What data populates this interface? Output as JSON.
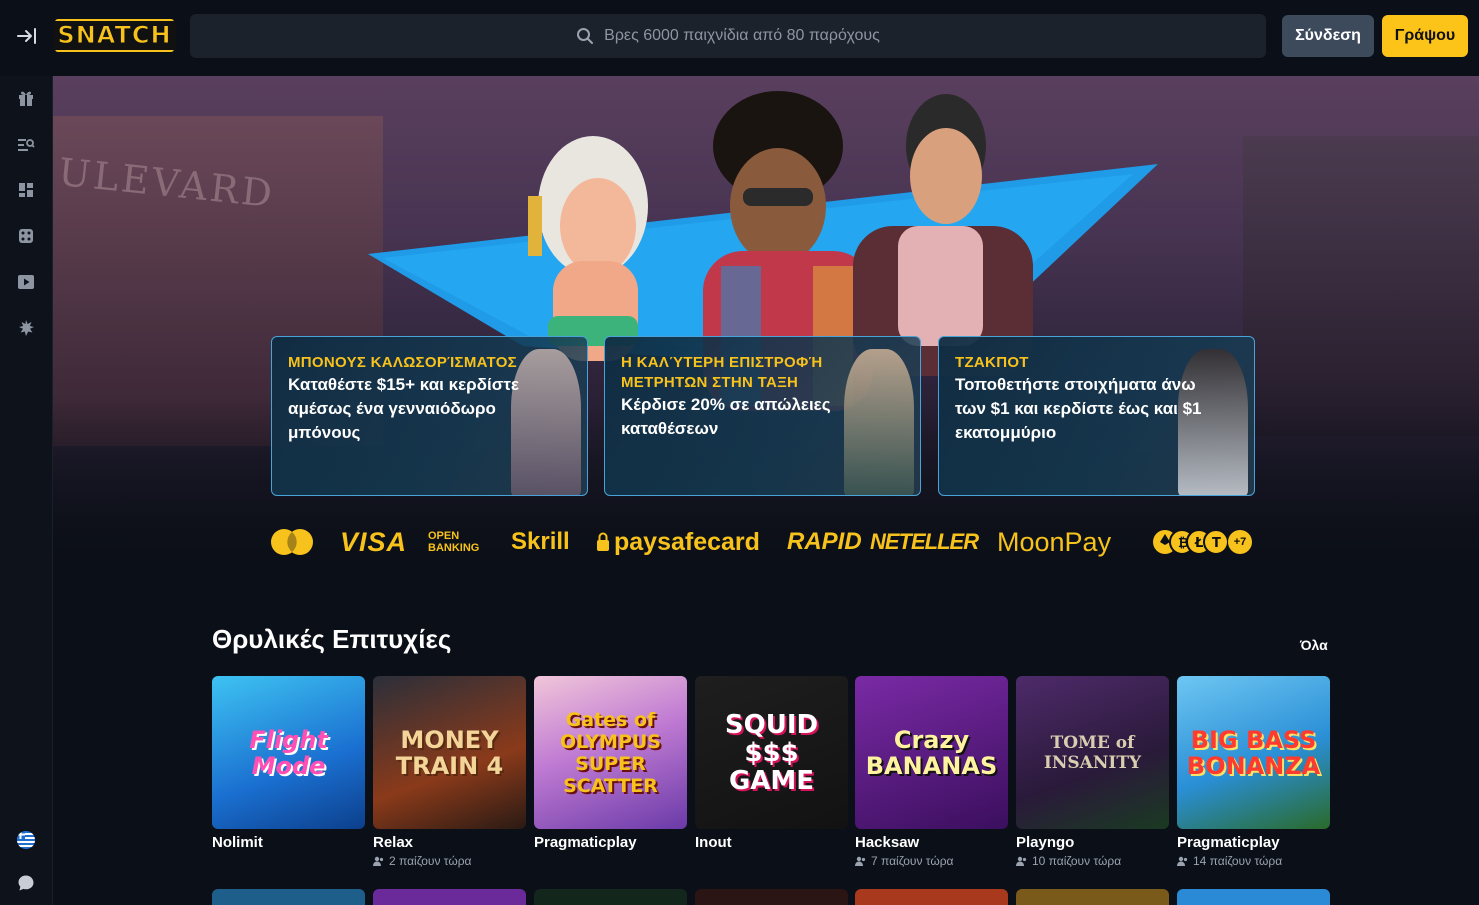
{
  "header": {
    "logo_text": "SNATCH",
    "search_placeholder": "Βρες 6000 παιχνίδια από 80 παρόχους",
    "login_label": "Σύνδεση",
    "register_label": "Γράψου"
  },
  "sidebar": {
    "items": [
      "gift-icon",
      "search-list-icon",
      "dashboard-icon",
      "dice-icon",
      "play-icon",
      "burst-icon"
    ],
    "bottom": [
      "greek-flag-icon",
      "chat-icon"
    ]
  },
  "hero": {
    "sign_text": "ULEVARD"
  },
  "promos": [
    {
      "title": "ΜΠΟΝΟΥΣ ΚΑΛΩΣΟΡΊΣΜΑΤΟΣ",
      "text": "Καταθέστε $15+ και κερδίστε αμέσως ένα γενναιόδωρο μπόνους"
    },
    {
      "title": "Η ΚΑΛΎΤΕΡΗ ΕΠΙΣΤΡΟΦΉ ΜΕΤΡΗΤΩΝ ΣΤΗΝ ΤΑΞΗ",
      "text": "Κέρδισε 20% σε απώλειες καταθέσεων"
    },
    {
      "title": "ΤΖΑΚΠΟΤ",
      "text": "Τοποθετήστε στοιχήματα άνω των $1 και κερδίστε έως και $1 εκατομμύριο"
    }
  ],
  "payments": {
    "visa": "VISA",
    "open_banking_1": "OPEN",
    "open_banking_2": "BANKING",
    "skrill": "Skrill",
    "paysafe": "paysafecard",
    "rapid": "RAPID",
    "neteller": "NETELLER",
    "moonpay": "MoonPay",
    "crypto_more": "+7"
  },
  "section": {
    "title": "Θρυλικές Επιτυχίες",
    "see_all": "Όλα"
  },
  "games": [
    {
      "name": "Flight Mode",
      "provider": "Nolimit",
      "players": ""
    },
    {
      "name": "MONEY TRAIN 4",
      "provider": "Relax",
      "players": "2 παίζουν τώρα"
    },
    {
      "name": "Gates of OLYMPUS SUPER SCATTER",
      "provider": "Pragmaticplay",
      "players": ""
    },
    {
      "name": "SQUID $$$ GAME",
      "provider": "Inout",
      "players": ""
    },
    {
      "name": "Crazy BANANAS",
      "provider": "Hacksaw",
      "players": "7 παίζουν τώρα"
    },
    {
      "name": "TOME of INSANITY",
      "provider": "Playngo",
      "players": "10 παίζουν τώρα"
    },
    {
      "name": "BIG BASS BONANZA",
      "provider": "Pragmaticplay",
      "players": "14 παίζουν τώρα"
    }
  ],
  "colors": {
    "accent": "#fcc419",
    "login_bg": "#3d4a5c",
    "page_bg": "#0b0f17",
    "promo_border": "#4aa3d8"
  }
}
